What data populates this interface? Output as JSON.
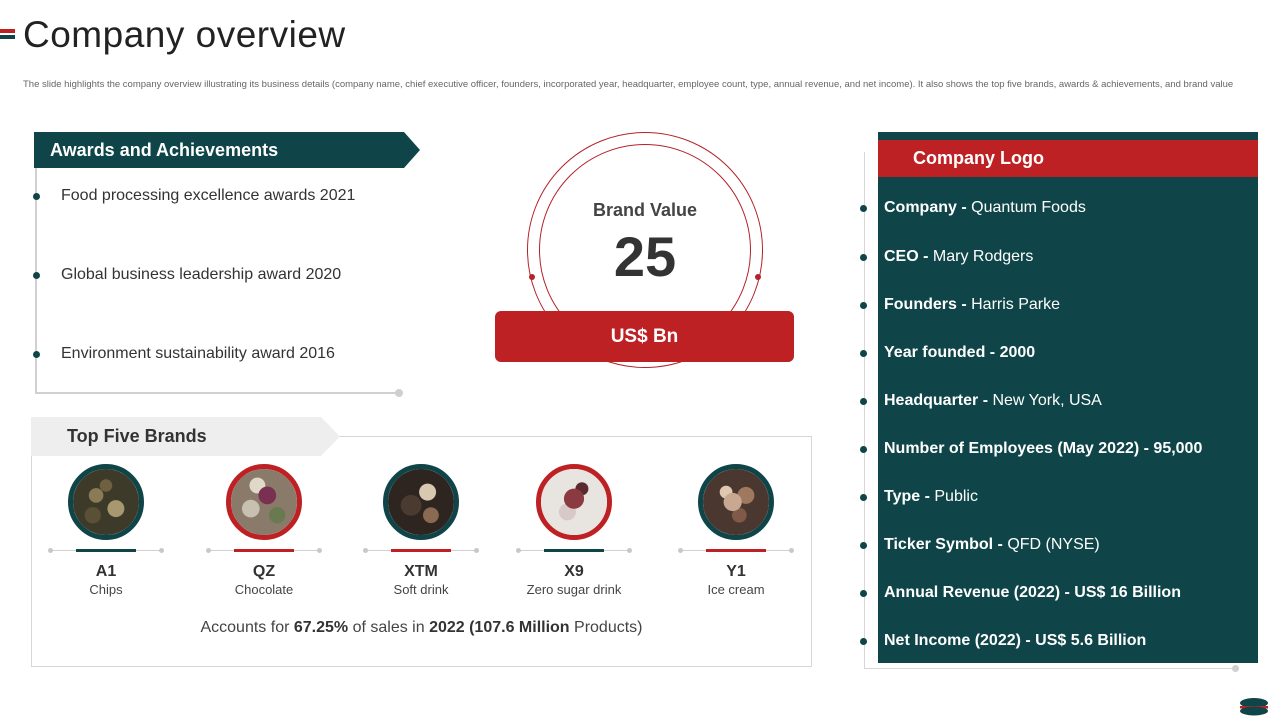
{
  "header": {
    "title": "Company overview",
    "subtitle": "The slide highlights the company overview illustrating its business details (company name, chief executive officer, founders, incorporated year, headquarter, employee count, type, annual revenue, and net income). It also shows the top five brands, awards & achievements, and brand value"
  },
  "awards": {
    "title": "Awards and Achievements",
    "items": [
      "Food processing excellence  awards 2021",
      "Global business leadership award 2020",
      "Environment  sustainability award 2016"
    ]
  },
  "brand_value": {
    "label": "Brand Value",
    "value": "25",
    "unit": "US$ Bn"
  },
  "brands": {
    "title": "Top Five Brands",
    "items": [
      {
        "code": "A1",
        "name": "Chips"
      },
      {
        "code": "QZ",
        "name": "Chocolate"
      },
      {
        "code": "XTM",
        "name": "Soft drink"
      },
      {
        "code": "X9",
        "name": "Zero  sugar drink"
      },
      {
        "code": "Y1",
        "name": "Ice cream"
      }
    ],
    "footer": {
      "prefix": "Accounts for ",
      "percent": "67.25%",
      "middle": " of sales in ",
      "year_products": "2022 (107.6 Million",
      "suffix": " Products)"
    }
  },
  "company": {
    "logo_label": "Company Logo",
    "rows": [
      {
        "key": "Company - ",
        "value": "Quantum  Foods"
      },
      {
        "key": "CEO - ",
        "value": "Mary Rodgers"
      },
      {
        "key": "Founders - ",
        "value": "Harris Parke"
      },
      {
        "key": "Year founded - 2000",
        "value": ""
      },
      {
        "key": "Headquarter - ",
        "value": "New York,  USA"
      },
      {
        "key": "Number of Employees (May 2022) - 95,000",
        "value": ""
      },
      {
        "key": "Type - ",
        "value": "Public"
      },
      {
        "key": "Ticker Symbol - ",
        "value": "QFD (NYSE)"
      },
      {
        "key": "Annual Revenue (2022) - US$ 16 Billion",
        "value": ""
      },
      {
        "key": "Net Income (2022) - US$ 5.6 Billion",
        "value": ""
      }
    ]
  },
  "colors": {
    "teal": "#0f4548",
    "red": "#be2124"
  }
}
